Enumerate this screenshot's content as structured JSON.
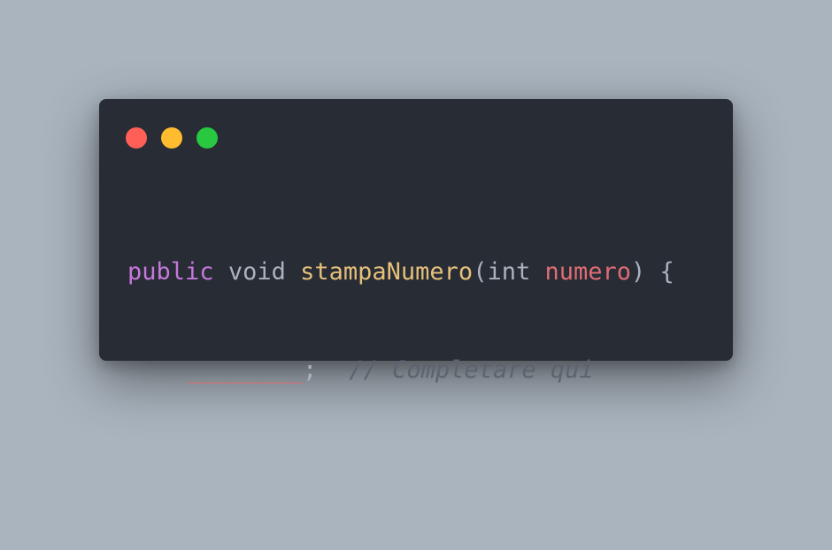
{
  "window": {
    "controls": {
      "close_color": "#ff5f57",
      "minimize_color": "#febc2e",
      "maximize_color": "#28c840"
    }
  },
  "code": {
    "line1": {
      "modifier": "public",
      "return_type": "void",
      "function_name": "stampaNumero",
      "open_paren": "(",
      "param_type": "int",
      "param_name": "numero",
      "close_paren_brace": ") {"
    },
    "line2": {
      "blank": "________",
      "semicolon": ";",
      "comment": "// Completare qui"
    },
    "line3": {
      "closing_brace": "}"
    }
  }
}
